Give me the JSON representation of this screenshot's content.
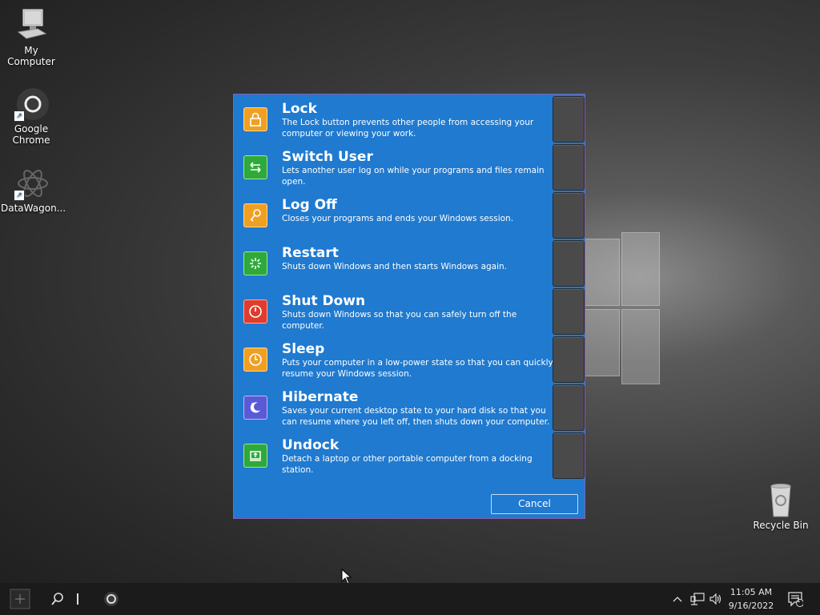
{
  "desktop": {
    "icons": [
      {
        "label": "My Computer",
        "icon": "computer-icon"
      },
      {
        "label": "Google Chrome",
        "icon": "chrome-icon"
      },
      {
        "label": "DataWagon...",
        "icon": "datawagon-icon"
      },
      {
        "label": "Recycle Bin",
        "icon": "recycle-bin-icon"
      }
    ]
  },
  "dialog": {
    "options": [
      {
        "title": "Lock",
        "desc": "The Lock button prevents other people from accessing your computer or viewing your work.",
        "icon": "lock-icon",
        "color": "#f0a020"
      },
      {
        "title": "Switch User",
        "desc": "Lets another user log on while your programs and files remain open.",
        "icon": "switch-user-icon",
        "color": "#2eaa3a"
      },
      {
        "title": "Log Off",
        "desc": "Closes your programs and ends your Windows session.",
        "icon": "key-icon",
        "color": "#f0a020"
      },
      {
        "title": "Restart",
        "desc": "Shuts down Windows and then starts Windows again.",
        "icon": "restart-icon",
        "color": "#2eaa3a"
      },
      {
        "title": "Shut Down",
        "desc": "Shuts down Windows so that you can safely turn off the computer.",
        "icon": "power-icon",
        "color": "#e03c2c"
      },
      {
        "title": "Sleep",
        "desc": "Puts your computer in a low-power state so that you can quickly resume your Windows session.",
        "icon": "sleep-icon",
        "color": "#f0a020"
      },
      {
        "title": "Hibernate",
        "desc": "Saves your current desktop state to your hard disk so that you can resume where you left off, then shuts down your computer.",
        "icon": "moon-icon",
        "color": "#5a5ad8"
      },
      {
        "title": "Undock",
        "desc": "Detach a laptop or other portable computer from a docking station.",
        "icon": "undock-icon",
        "color": "#2eaa3a"
      }
    ],
    "cancel_label": "Cancel"
  },
  "taskbar": {
    "time": "11:05 AM",
    "date": "9/16/2022",
    "notification_count": "1"
  }
}
